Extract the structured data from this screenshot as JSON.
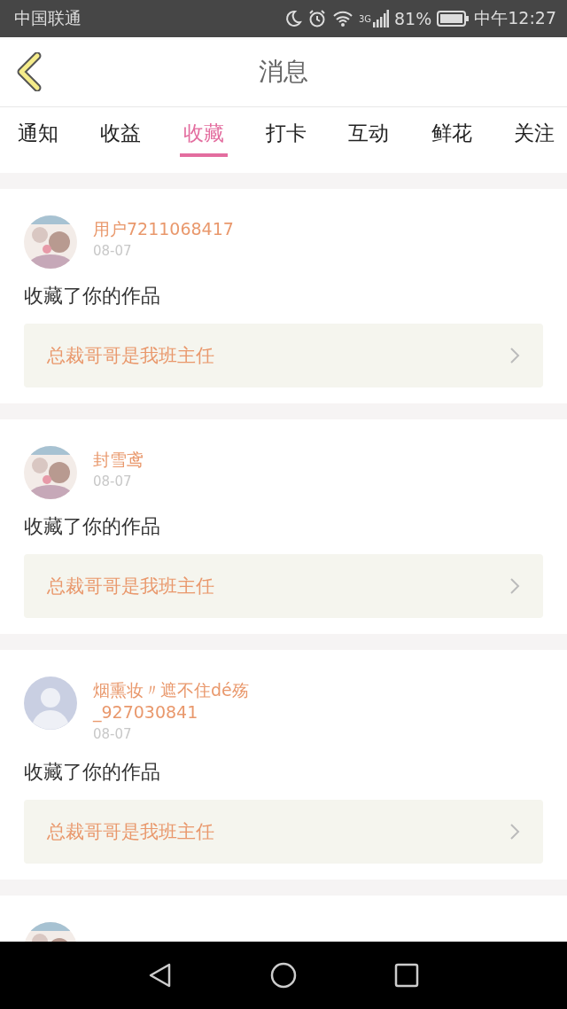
{
  "status_bar": {
    "carrier": "中国联通",
    "network": "3G",
    "battery": "81%",
    "time": "中午12:27"
  },
  "header": {
    "title": "消息"
  },
  "tabs": [
    {
      "label": "通知",
      "selected": false
    },
    {
      "label": "收益",
      "selected": false
    },
    {
      "label": "收藏",
      "selected": true
    },
    {
      "label": "打卡",
      "selected": false
    },
    {
      "label": "互动",
      "selected": false
    },
    {
      "label": "鲜花",
      "selected": false
    },
    {
      "label": "关注",
      "selected": false
    }
  ],
  "messages": [
    {
      "avatar": {
        "kind": "picture"
      },
      "user": "用户7211068417",
      "date": "08-07",
      "action": "收藏了你的作品",
      "work": "总裁哥哥是我班主任"
    },
    {
      "avatar": {
        "kind": "picture"
      },
      "user": "封雪鸢",
      "date": "08-07",
      "action": "收藏了你的作品",
      "work": "总裁哥哥是我班主任"
    },
    {
      "avatar": {
        "kind": "default"
      },
      "user": "烟熏妆〃遮不住dé殇_927030841",
      "date": "08-07",
      "action": "收藏了你的作品",
      "work": "总裁哥哥是我班主任"
    },
    {
      "avatar": {
        "kind": "picture"
      }
    }
  ]
}
